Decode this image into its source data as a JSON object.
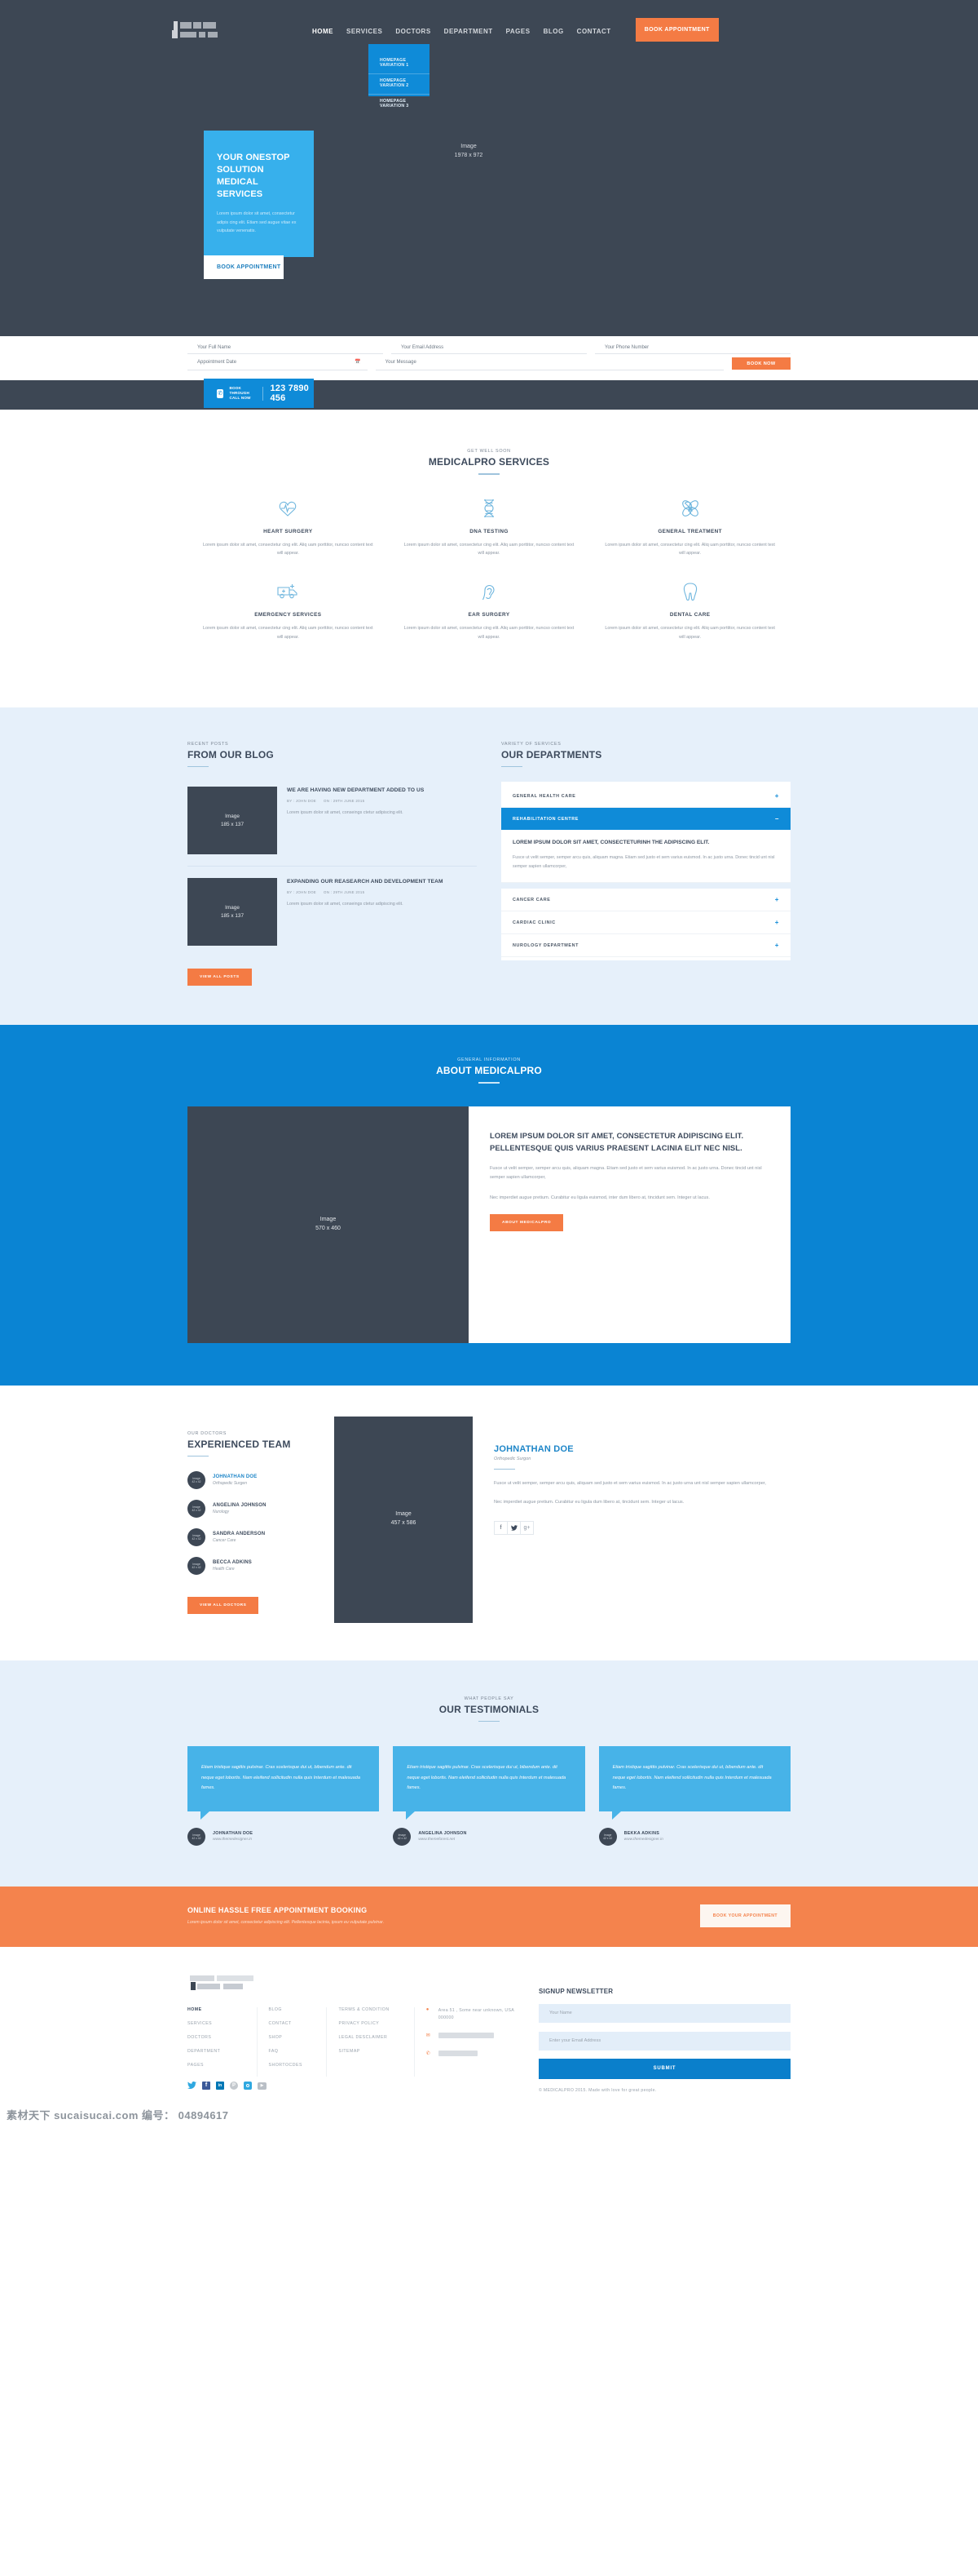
{
  "colors": {
    "dark": "#3d4754",
    "blue": "#0f8bd8",
    "light_blue": "#37b0ec",
    "orange": "#f47b44",
    "pale_blue_bg": "#e6f0fa"
  },
  "header": {
    "nav": [
      {
        "label": "HOME",
        "active": true
      },
      {
        "label": "SERVICES",
        "active": false
      },
      {
        "label": "DOCTORS",
        "active": false
      },
      {
        "label": "DEPARTMENT",
        "active": false
      },
      {
        "label": "PAGES",
        "active": false
      },
      {
        "label": "BLOG",
        "active": false
      },
      {
        "label": "CONTACT",
        "active": false
      }
    ],
    "cta_label": "BOOK APPOINTMENT",
    "dropdown": [
      "HOMEPAGE VARIATION 1",
      "HOMEPAGE VARIATION 2",
      "HOMEPAGE VARIATION 3"
    ]
  },
  "hero": {
    "title": "YOUR ONESTOP SOLUTION MEDICAL SERVICES",
    "body": "Lorem ipsum dolor sit amet, consectetur adipis cing elit. Etiam sed augue vitae ex vulputate venenatis.",
    "tab_label": "BOOK APPOINTMENT",
    "image_label": "Image",
    "image_size": "1978 x 972"
  },
  "appointment_form": {
    "full_name_placeholder": "Your Full Name",
    "email_placeholder": "Your Email Address",
    "phone_placeholder": "Your Phone Number",
    "date_placeholder": "Appointment Date",
    "message_placeholder": "Your Message",
    "submit_label": "BOOK NOW",
    "calendar_icon": "calendar-icon"
  },
  "call_bar": {
    "icon": "phone-icon",
    "label_line1": "BOOK THROUGH",
    "label_line2": "CALL NOW",
    "number": "123 7890 456"
  },
  "services": {
    "kicker": "GET WELL SOON",
    "title": "MEDICALPRO SERVICES",
    "items": [
      {
        "icon": "heart-pulse-icon",
        "title": "HEART SURGERY",
        "desc": "Lorem ipsum dolor sit amet, consectetur cing elit. Aliq uam porttitor, nuncso content text will appear."
      },
      {
        "icon": "dna-icon",
        "title": "DNA TESTING",
        "desc": "Lorem ipsum dolor sit amet, consectetur cing elit. Aliq uam porttitor, nuncso content text will appear."
      },
      {
        "icon": "bandage-icon",
        "title": "GENERAL TREATMENT",
        "desc": "Lorem ipsum dolor sit amet, consectetur cing elit. Aliq uam porttitor, nuncso content text will appear."
      },
      {
        "icon": "ambulance-icon",
        "title": "EMERGENCY SERVICES",
        "desc": "Lorem ipsum dolor sit amet, consectetur cing elit. Aliq uam porttitor, nuncso content text will appear."
      },
      {
        "icon": "ear-icon",
        "title": "EAR SURGERY",
        "desc": "Lorem ipsum dolor sit amet, consectetur cing elit. Aliq uam porttitor, nuncso content text will appear."
      },
      {
        "icon": "tooth-icon",
        "title": "DENTAL CARE",
        "desc": "Lorem ipsum dolor sit amet, consectetur cing elit. Aliq uam porttitor, nuncso content text will appear."
      }
    ]
  },
  "blog": {
    "kicker": "RECENT POSTS",
    "title": "FROM OUR BLOG",
    "posts": [
      {
        "image_label": "Image",
        "image_size": "185 x 137",
        "title": "WE ARE HAVING NEW DEPARTMENT ADDED TO US",
        "author": "BY : JOHN DOE",
        "date": "ON : 29TH JUNE 2015",
        "excerpt": "Lorem ipsum dolor sit amet, conseings ctetur adipiscing elit."
      },
      {
        "image_label": "Image",
        "image_size": "185 x 137",
        "title": "EXPANDING OUR REASEARCH AND DEVELOPMENT TEAM",
        "author": "BY : JOHN DOE",
        "date": "ON : 29TH JUNE 2015",
        "excerpt": "Lorem ipsum dolor sit amet, conseings ctetur adipiscing elit."
      }
    ],
    "view_all_label": "VIEW ALL POSTS"
  },
  "departments": {
    "kicker": "VARIETY OF SERVICES",
    "title": "OUR DEPARTMENTS",
    "items": [
      {
        "label": "GENERAL HEALTH CARE",
        "open": false,
        "sign": "+"
      },
      {
        "label": "REHABILITATION CENTRE",
        "open": true,
        "sign": "–"
      },
      {
        "label": "CANCER CARE",
        "open": false,
        "sign": "+"
      },
      {
        "label": "CARDIAC CLINIC",
        "open": false,
        "sign": "+"
      },
      {
        "label": "NUROLOGY DEPARTMENT",
        "open": false,
        "sign": "+"
      }
    ],
    "open_panel": {
      "heading": "LOREM IPSUM DOLOR SIT AMET, CONSECTETURINH THE ADIPISCING ELIT.",
      "body": "Fusce ut velit semper, semper arcu quis, aliquam magna. Etiam sed justo et sem varius euismod. In ac justo urna. Donec tincid unt nisl semper sapien ullamcorper,"
    }
  },
  "about": {
    "kicker": "GENERAL INFORMATION",
    "title": "ABOUT MEDICALPRO",
    "image_label": "Image",
    "image_size": "570 x 460",
    "heading": "LOREM IPSUM DOLOR SIT AMET, CONSECTETUR ADIPISCING ELIT. PELLENTESQUE QUIS VARIUS PRAESENT LACINIA ELIT NEC NISL.",
    "para1": "Fusce ut velit semper, semper arcu quis, aliquam magna. Etiam sed justo et sem varius euismod. In ac justo urna. Donec tincid unt nisl semper sapien ullamcorper,",
    "para2": "Nec imperdiet augue pretium. Curabitur eu ligula euismod, inter dum libero at, tincidunt sem. Integer ut lacus.",
    "button_label": "ABOUT MEDICALPRO"
  },
  "doctors": {
    "kicker": "OUR DOCTORS",
    "title": "EXPERIENCED TEAM",
    "list": [
      {
        "avatar_label": "Image",
        "avatar_size": "42 x 42",
        "name": "JOHNATHAN DOE",
        "role": "Orthopedic Surgen",
        "selected": true
      },
      {
        "avatar_label": "Image",
        "avatar_size": "42 x 42",
        "name": "ANGELINA JOHNSON",
        "role": "Nurology",
        "selected": false
      },
      {
        "avatar_label": "Image",
        "avatar_size": "42 x 42",
        "name": "SANDRA ANDERSON",
        "role": "Cancer Care",
        "selected": false
      },
      {
        "avatar_label": "Image",
        "avatar_size": "42 x 42",
        "name": "BECCA ADKINS",
        "role": "Health Care",
        "selected": false
      }
    ],
    "view_all_label": "VIEW ALL DOCTORS",
    "image_label": "Image",
    "image_size": "457 x 586",
    "detail": {
      "name": "JOHNATHAN DOE",
      "role": "Orthopedic Surgon",
      "para1": "Fusce ut velit semper, semper arcu quis, aliquam sed justo et sem varius euismod. In ac justo urna unt nisl semper sapien ullamcorper,",
      "para2": "Nec imperdiet augue pretium. Curabitur eu ligula dum libero at, tincidunt sem. Integer ut lacus.",
      "socials": [
        {
          "icon": "facebook-icon",
          "glyph": "f"
        },
        {
          "icon": "twitter-icon",
          "glyph": "✉"
        },
        {
          "icon": "google-plus-icon",
          "glyph": "g+"
        }
      ]
    }
  },
  "testimonials": {
    "kicker": "WHAT PEOPLE SAY",
    "title": "OUR TESTIMONIALS",
    "items": [
      {
        "quote": "Etiam tristique sagittis pulvinar. Cras scelerisque dui ut, bibendum ante. dit neque eget lobortis. Nam eleifend sollicitudin nulla quis Interdum et malesuada fames.",
        "avatar_label": "Image",
        "avatar_size": "42 x 42",
        "name": "JOHNATHAN DOE",
        "url": "www.themedesigner.in"
      },
      {
        "quote": "Etiam tristique sagittis pulvinar. Cras scelerisque dui ut, bibendum ante. dit neque eget lobortis. Nam eleifend sollicitudin nulla quis Interdum et malesuada fames.",
        "avatar_label": "Image",
        "avatar_size": "42 x 42",
        "name": "ANGELINA JOHNSON",
        "url": "www.themeforest.net"
      },
      {
        "quote": "Etiam tristique sagittis pulvinar. Cras scelerisque dui ut, bibendum ante. dit neque eget lobortis. Nam eleifend sollicitudin nulla quis Interdum et malesuada fames.",
        "avatar_label": "Image",
        "avatar_size": "42 x 42",
        "name": "BEKKA ADKINS",
        "url": "www.themedesigner.in"
      }
    ]
  },
  "cta": {
    "title": "ONLINE HASSLE FREE APPOINTMENT BOOKING",
    "subtitle": "Lorem ipsum dolor sit amet, consectetur adipiscing elit. Pellentesque lacinia, ipsum eu vulputate pulvinar.",
    "button_label": "BOOK YOUR APPOINTMENT"
  },
  "footer": {
    "col1": [
      {
        "label": "HOME",
        "active": true
      },
      {
        "label": "SERVICES",
        "active": false
      },
      {
        "label": "DOCTORS",
        "active": false
      },
      {
        "label": "DEPARTMENT",
        "active": false
      },
      {
        "label": "PAGES",
        "active": false
      }
    ],
    "col2": [
      {
        "label": "BLOG",
        "active": false
      },
      {
        "label": "CONTACT",
        "active": false
      },
      {
        "label": "SHOP",
        "active": false
      },
      {
        "label": "FAQ",
        "active": false
      },
      {
        "label": "SHORTOCDES",
        "active": false
      }
    ],
    "col3": [
      {
        "label": "TERMS & CONDITION",
        "active": false
      },
      {
        "label": "PRIVACY POLICY",
        "active": false
      },
      {
        "label": "LEGAL DESCLAIMER",
        "active": false
      },
      {
        "label": "SITEMAP",
        "active": false
      }
    ],
    "contact": {
      "address_icon": "map-pin-icon",
      "address": "Area  51 , Some near unknown, USA 000000",
      "email_icon": "envelope-icon",
      "phone_icon": "phone-icon"
    },
    "socials": [
      {
        "icon": "twitter-icon",
        "glyph": "➤",
        "color": "#2fa8e0"
      },
      {
        "icon": "facebook-icon",
        "glyph": "f",
        "color": "#3b5998"
      },
      {
        "icon": "linkedin-icon",
        "glyph": "in",
        "color": "#0077b5"
      },
      {
        "icon": "pinterest-icon",
        "glyph": "P",
        "color": "#bd081c"
      },
      {
        "icon": "instagram-icon",
        "glyph": "▣",
        "color": "#2fa8e0"
      },
      {
        "icon": "youtube-icon",
        "glyph": "▶",
        "color": "#cc181e"
      }
    ],
    "newsletter": {
      "title": "SIGNUP NEWSLETTER",
      "name_placeholder": "Your Name",
      "email_placeholder": "Enter your Email Address",
      "submit_label": "SUBMIT"
    },
    "copyright": "© MEDICALPRO 2015. Made with love for great people."
  },
  "watermark": {
    "text": "素材天下 sucaisucai.com   编号： 04894617"
  }
}
